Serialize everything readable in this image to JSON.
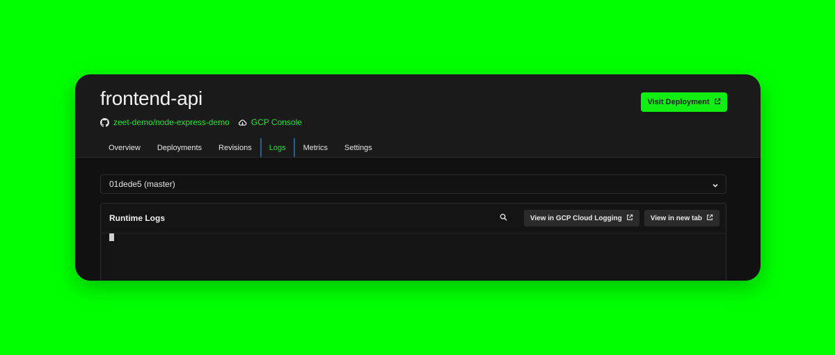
{
  "service": {
    "title": "frontend-api",
    "repo_link": "zeet-demo/node-express-demo",
    "console_link": "GCP Console",
    "visit_button": "Visit Deployment"
  },
  "tabs": [
    {
      "label": "Overview",
      "active": false
    },
    {
      "label": "Deployments",
      "active": false
    },
    {
      "label": "Revisions",
      "active": false
    },
    {
      "label": "Logs",
      "active": true
    },
    {
      "label": "Metrics",
      "active": false
    },
    {
      "label": "Settings",
      "active": false
    }
  ],
  "deployment_select": {
    "value": "01dede5 (master)"
  },
  "logs": {
    "title": "Runtime Logs",
    "gcp_logging_button": "View in GCP Cloud Logging",
    "new_tab_button": "View in new tab"
  },
  "colors": {
    "accent": "#11ee11",
    "link_green": "#22e034",
    "background": "#00ff00",
    "panel": "#1a1a1a"
  },
  "icons": {
    "repo": "github-icon",
    "console": "cloud-icon",
    "external": "external-link-icon",
    "search": "search-icon",
    "dropdown": "chevron-down-icon"
  }
}
